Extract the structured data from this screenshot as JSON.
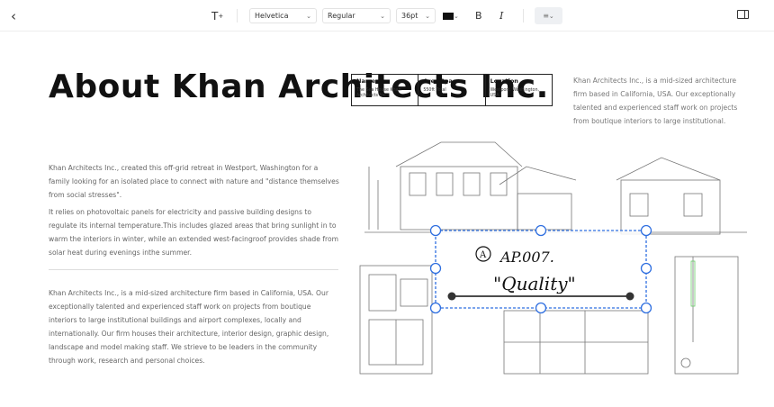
{
  "toolbar": {
    "font": "Helvetica",
    "weight": "Regular",
    "size": "36pt",
    "color": "#111111",
    "bold": "B",
    "italic": "I"
  },
  "title": "About Khan Architects Inc.",
  "paragraphs": [
    "Khan Architects Inc., created this off-grid retreat in Westport, Washington for a family looking for an isolated place to connect with nature and \"distance themselves from social stresses\".",
    "It relies on photovoltaic panels for electricity and passive building designs to regulate its internal temperature.This includes glazed areas that bring sunlight in to warm the interiors in winter, while an extended west-facingroof provides shade from solar heat during evenings inthe summer.",
    "Khan Architects Inc., is a mid-sized architecture firm based in California, USA. Our exceptionally talented and experienced staff work on projects from boutique interiors to large institutional buildings and airport complexes, locally and internationally. Our firm houses their architecture, interior design, graphic design, landscape and model making staff. We strieve to be leaders in the community through work, research and personal choices."
  ],
  "info_table": [
    {
      "header": "Name",
      "value": "The Sea House Khan Architects Inc"
    },
    {
      "header": "Ares Space",
      "value": "550ft Total"
    },
    {
      "header": "Location",
      "value": "Westport, Washington, USA"
    }
  ],
  "side_text": "Khan Architects Inc., is a mid-sized architecture firm based in California, USA. Our exceptionally talented and experienced staff work on projects from boutique interiors to large institutional.",
  "annotation": {
    "line1": "AP.007.",
    "line2": "\"Quality\"",
    "accent": "#2f6fe0"
  }
}
